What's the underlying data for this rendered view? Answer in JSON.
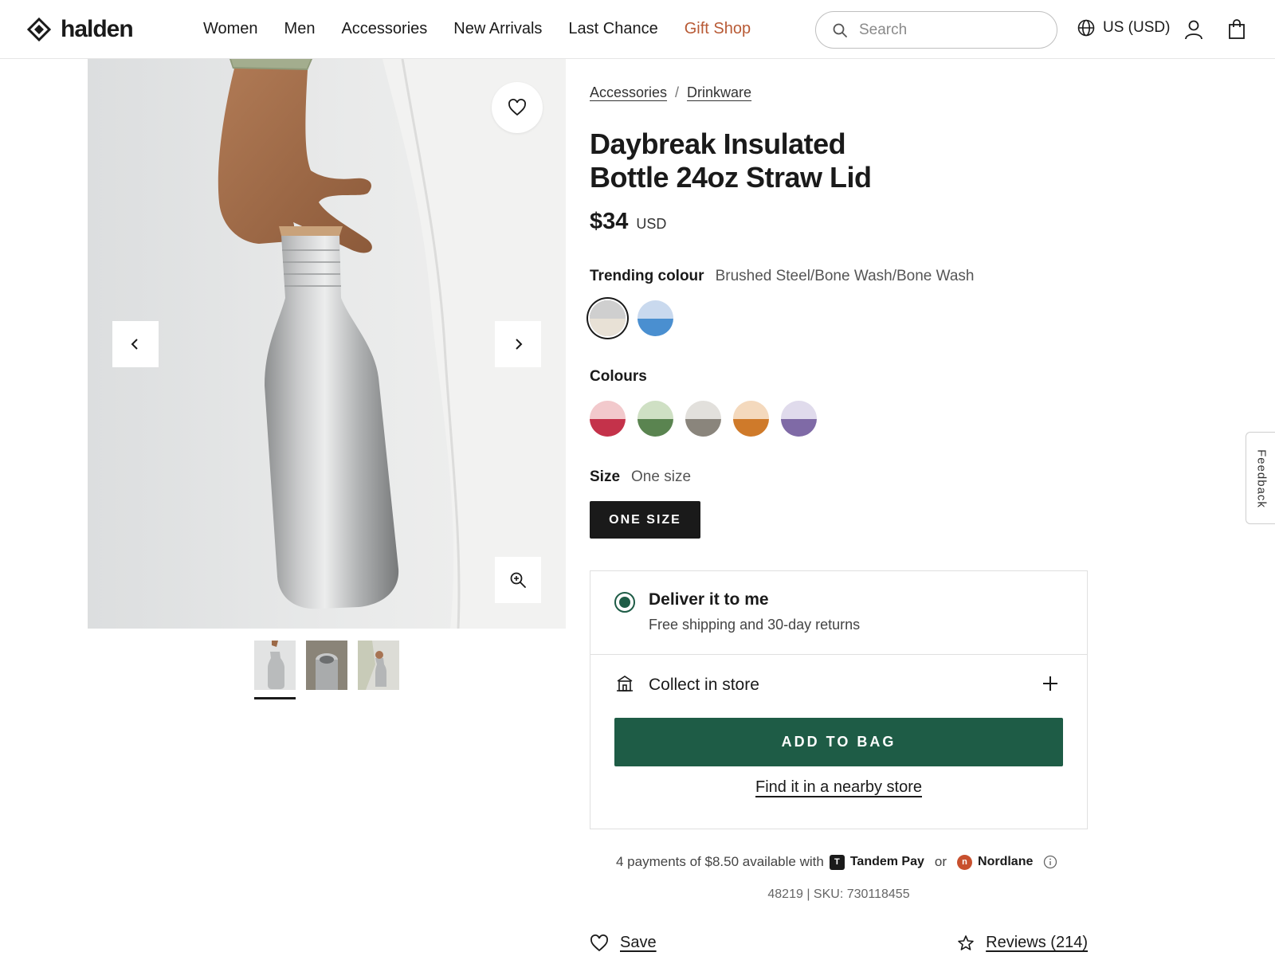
{
  "header": {
    "brand": "halden",
    "nav": [
      {
        "label": "Women"
      },
      {
        "label": "Men"
      },
      {
        "label": "Accessories"
      },
      {
        "label": "New Arrivals"
      },
      {
        "label": "Last Chance"
      },
      {
        "label": "Gift Shop",
        "highlight": "#b85a35"
      }
    ],
    "search_placeholder": "Search",
    "region": "US (USD)",
    "icons": {
      "logo": "diamond-logo-icon",
      "search": "search-icon",
      "globe": "globe-icon",
      "account": "user-icon",
      "bag": "shopping-bag-icon"
    }
  },
  "gallery": {
    "thumbnails": 3,
    "active_thumbnail": 1,
    "icons": {
      "favorite": "heart-icon",
      "prev": "chevron-left-icon",
      "next": "chevron-right-icon",
      "zoom": "zoom-in-icon"
    }
  },
  "product": {
    "breadcrumb": [
      "Accessories",
      "Drinkware"
    ],
    "breadcrumb_sep": "/",
    "title_line1": "Daybreak Insulated",
    "title_line2": "Bottle 24oz Straw Lid",
    "price": "$34",
    "currency": "USD",
    "trending_label": "Trending colour",
    "trending_value": "Brushed Steel/Bone Wash/Bone Wash",
    "trending_swatches": [
      {
        "top": "#cfcfcf",
        "bottom": "#e8e1d6",
        "selected": true
      },
      {
        "top": "#c9d9ee",
        "bottom": "#4a8fd0",
        "selected": false
      }
    ],
    "colours_label": "Colours",
    "colour_swatches": [
      {
        "top": "#f2c9cc",
        "bottom": "#c4324a"
      },
      {
        "top": "#cfe0c4",
        "bottom": "#5a8450"
      },
      {
        "top": "#e2e0dc",
        "bottom": "#8a857c"
      },
      {
        "top": "#f4d9bd",
        "bottom": "#cf7a2a"
      },
      {
        "top": "#e0dbec",
        "bottom": "#7f6aa6"
      }
    ],
    "size_label": "Size",
    "size_value": "One size",
    "size_button": "ONE SIZE"
  },
  "fulfilment": {
    "deliver_title": "Deliver it to me",
    "deliver_sub": "Free shipping and 30-day returns",
    "collect_label": "Collect in store",
    "add_to_bag": "ADD TO BAG",
    "find_store": "Find it in a nearby store",
    "accent": "#1e5c46"
  },
  "payments": {
    "text": "4 payments of $8.50 available with",
    "provider1": "Tandem Pay",
    "provider1_badge": "T",
    "or": "or",
    "provider2": "Nordlane",
    "provider2_badge": "n"
  },
  "sku": "48219 | SKU: 730118455",
  "actions": {
    "save": "Save",
    "reviews": "Reviews (214)"
  },
  "feedback": "Feedback"
}
